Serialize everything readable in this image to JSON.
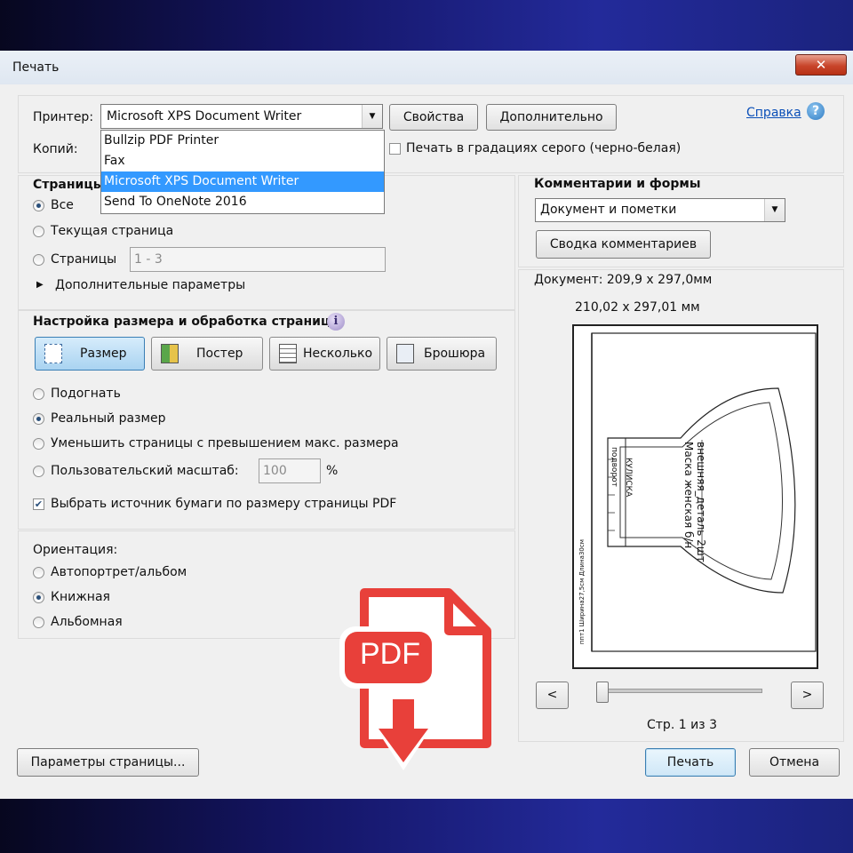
{
  "window": {
    "title": "Печать",
    "close_glyph": "✕"
  },
  "printer": {
    "label": "Принтер:",
    "selected": "Microsoft XPS Document Writer",
    "options": [
      "Bullzip PDF Printer",
      "Fax",
      "Microsoft XPS Document Writer",
      "Send To OneNote 2016"
    ],
    "properties_btn": "Свойства",
    "advanced_btn": "Дополнительно",
    "help_link": "Справка",
    "copies_label": "Копий:",
    "grayscale_label": "Печать в градациях серого (черно-белая)",
    "grayscale_checked": false
  },
  "pages": {
    "title": "Страницы",
    "all_label": "Все",
    "current_label": "Текущая страница",
    "range_label": "Страницы",
    "range_value": "1 - 3",
    "more_label": "Дополнительные параметры",
    "selected": "all"
  },
  "sizing": {
    "title": "Настройка размера и обработка страниц",
    "tabs": [
      "Размер",
      "Постер",
      "Несколько",
      "Брошюра"
    ],
    "active_tab": "Размер",
    "fit_label": "Подогнать",
    "actual_label": "Реальный размер",
    "shrink_label": "Уменьшить страницы с превышением макс. размера",
    "custom_label": "Пользовательский масштаб:",
    "custom_value": "100",
    "percent": "%",
    "paper_source_label": "Выбрать источник бумаги по размеру страницы PDF",
    "paper_source_checked": true,
    "selected": "actual"
  },
  "orientation": {
    "title": "Ориентация:",
    "auto_label": "Автопортрет/альбом",
    "portrait_label": "Книжная",
    "landscape_label": "Альбомная",
    "selected": "portrait"
  },
  "comments": {
    "title": "Комментарии и формы",
    "selected": "Документ и пометки",
    "summary_btn": "Сводка комментариев"
  },
  "preview": {
    "document_size": "Документ: 209,9 x 297,0мм",
    "paper_size": "210,02 x 297,01 мм",
    "page_indicator": "Стр. 1 из 3",
    "prev": "<",
    "next": ">",
    "pattern_text_1": "Маска  женская  б/н",
    "pattern_text_2": "внешняя_деталь  2шт",
    "pattern_text_3": "КУЛИСКА",
    "pattern_text_4": "подворот",
    "pattern_side_text": "ппт1 Ширина27,5см Длина30см",
    "slider_position": 0
  },
  "footer": {
    "page_setup_btn": "Параметры страницы...",
    "print_btn": "Печать",
    "cancel_btn": "Отмена"
  },
  "overlay": {
    "pdf_badge": "PDF",
    "brand_color": "#e8403a"
  }
}
